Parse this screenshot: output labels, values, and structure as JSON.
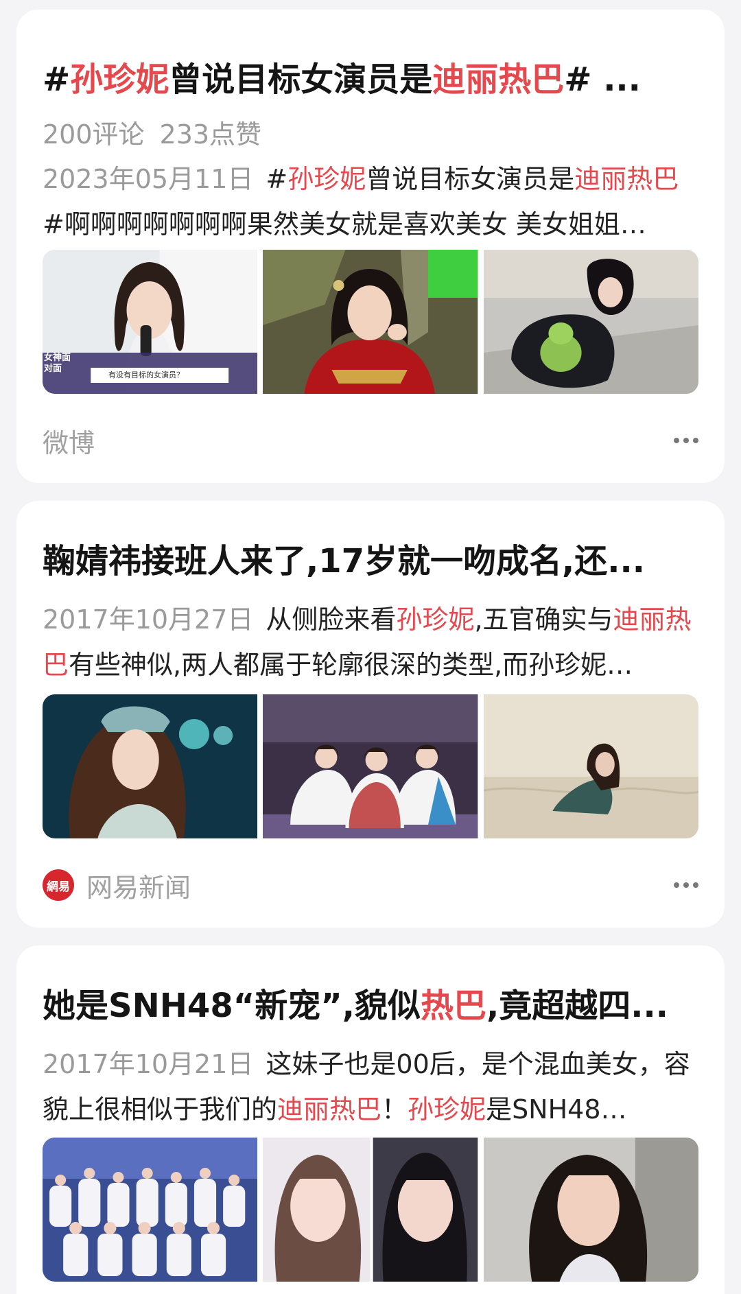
{
  "cards": [
    {
      "title_parts": [
        {
          "text": "#",
          "hl": false
        },
        {
          "text": "孙珍妮",
          "hl": true
        },
        {
          "text": "曾说目标女演员是",
          "hl": false
        },
        {
          "text": "迪丽热巴",
          "hl": true
        },
        {
          "text": "# ...",
          "hl": false
        }
      ],
      "comments": "200评论",
      "likes": "233点赞",
      "date": "2023年05月11日",
      "snippet_parts": [
        {
          "text": "#",
          "hl": false
        },
        {
          "text": "孙珍妮",
          "hl": true
        },
        {
          "text": "曾说目标女演员是",
          "hl": false
        },
        {
          "text": "迪丽热巴",
          "hl": true
        },
        {
          "text": "#啊啊啊啊啊啊啊果然美女就是喜欢美女 美女姐姐…",
          "hl": false
        }
      ],
      "thumb_caption_1": "有没有目标的女演员？",
      "thumb_badge_1": "女神面对面",
      "source": "微博"
    },
    {
      "title": "鞠婧祎接班人来了,17岁就一吻成名,还...",
      "date": "2017年10月27日",
      "snippet_parts": [
        {
          "text": "从侧脸来看",
          "hl": false
        },
        {
          "text": "孙珍妮",
          "hl": true
        },
        {
          "text": ",五官确实与",
          "hl": false
        },
        {
          "text": "迪丽热巴",
          "hl": true
        },
        {
          "text": "有些神似,两人都属于轮廓很深的类型,而孙珍妮…",
          "hl": false
        }
      ],
      "source": "网易新闻",
      "source_logo": "網易"
    },
    {
      "title_parts": [
        {
          "text": "她是SNH48“新宠”,貌似",
          "hl": false
        },
        {
          "text": "热巴",
          "hl": true
        },
        {
          "text": ",竟超越四...",
          "hl": false
        }
      ],
      "date": "2017年10月21日",
      "snippet_parts": [
        {
          "text": "这妹子也是00后，是个混血美女，容貌上很相似于我们的",
          "hl": false
        },
        {
          "text": "迪丽热巴",
          "hl": true
        },
        {
          "text": "！",
          "hl": false
        },
        {
          "text": "孙珍妮",
          "hl": true
        },
        {
          "text": "是SNH48…",
          "hl": false
        }
      ]
    }
  ],
  "colors": {
    "highlight": "#e5484d",
    "background": "#f4f4f6",
    "card": "#ffffff",
    "muted": "#9a9a9a"
  },
  "icons": [
    "more-dots-icon",
    "netease-logo-icon"
  ]
}
